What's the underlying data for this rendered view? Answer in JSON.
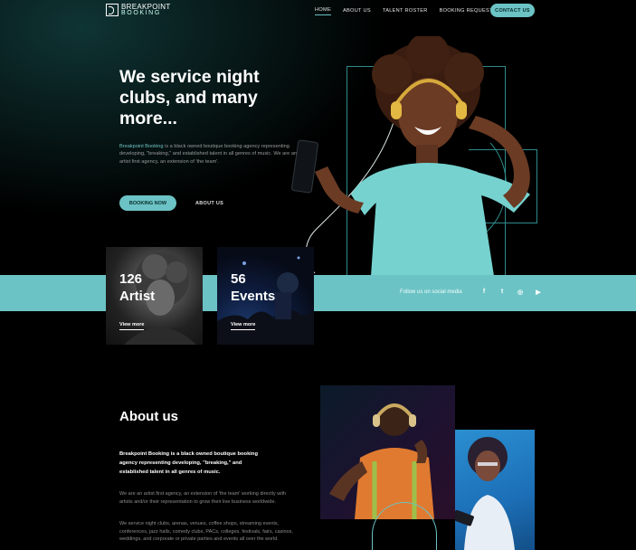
{
  "header": {
    "logo_line1": "BREAKPOINT",
    "logo_line2": "BOOKING",
    "nav": [
      {
        "label": "HOME",
        "active": true
      },
      {
        "label": "ABOUT US",
        "active": false
      },
      {
        "label": "TALENT ROSTER",
        "active": false
      },
      {
        "label": "BOOKING REQUEST",
        "active": false
      }
    ],
    "contact_label": "CONTACT US"
  },
  "hero": {
    "title": "We service night clubs, and many more...",
    "desc_highlight": "Breakpoint Booking",
    "desc_rest": " is a black owned boutique booking agency representing developing, \"breaking,\" and established talent in all genres of music. We are an artist first agency, an extension of 'the team'.",
    "booking_label": "BOOKING NOW",
    "about_label": "ABOUT US"
  },
  "stats": [
    {
      "number": "126",
      "label": "Artist",
      "link": "View more"
    },
    {
      "number": "56",
      "label": "Events",
      "link": "View more"
    }
  ],
  "band": {
    "follow_text": "Follow us on social media",
    "social_icons": [
      "facebook-icon",
      "twitter-icon",
      "instagram-icon",
      "youtube-icon"
    ],
    "social_glyphs": [
      "f",
      "t",
      "◎",
      "▶"
    ]
  },
  "about": {
    "title": "About us",
    "lead": "Breakpoint Booking is a black owned boutique booking agency representing developing, \"breaking,\" and established talent in all genres of music.",
    "p1": "We are an artist first agency, an extension of 'the team' working directly with artists and/or their representation to grow their live business worldwide.",
    "p2": "We service night clubs, arenas, venues, coffee shops, streaming events, conferences, jazz halls, comedy clubs, PACs, colleges, festivals, fairs, casinos, weddings, and corporate or private parties and events all over the world."
  },
  "colors": {
    "accent": "#6cc3c5",
    "background": "#000000"
  }
}
